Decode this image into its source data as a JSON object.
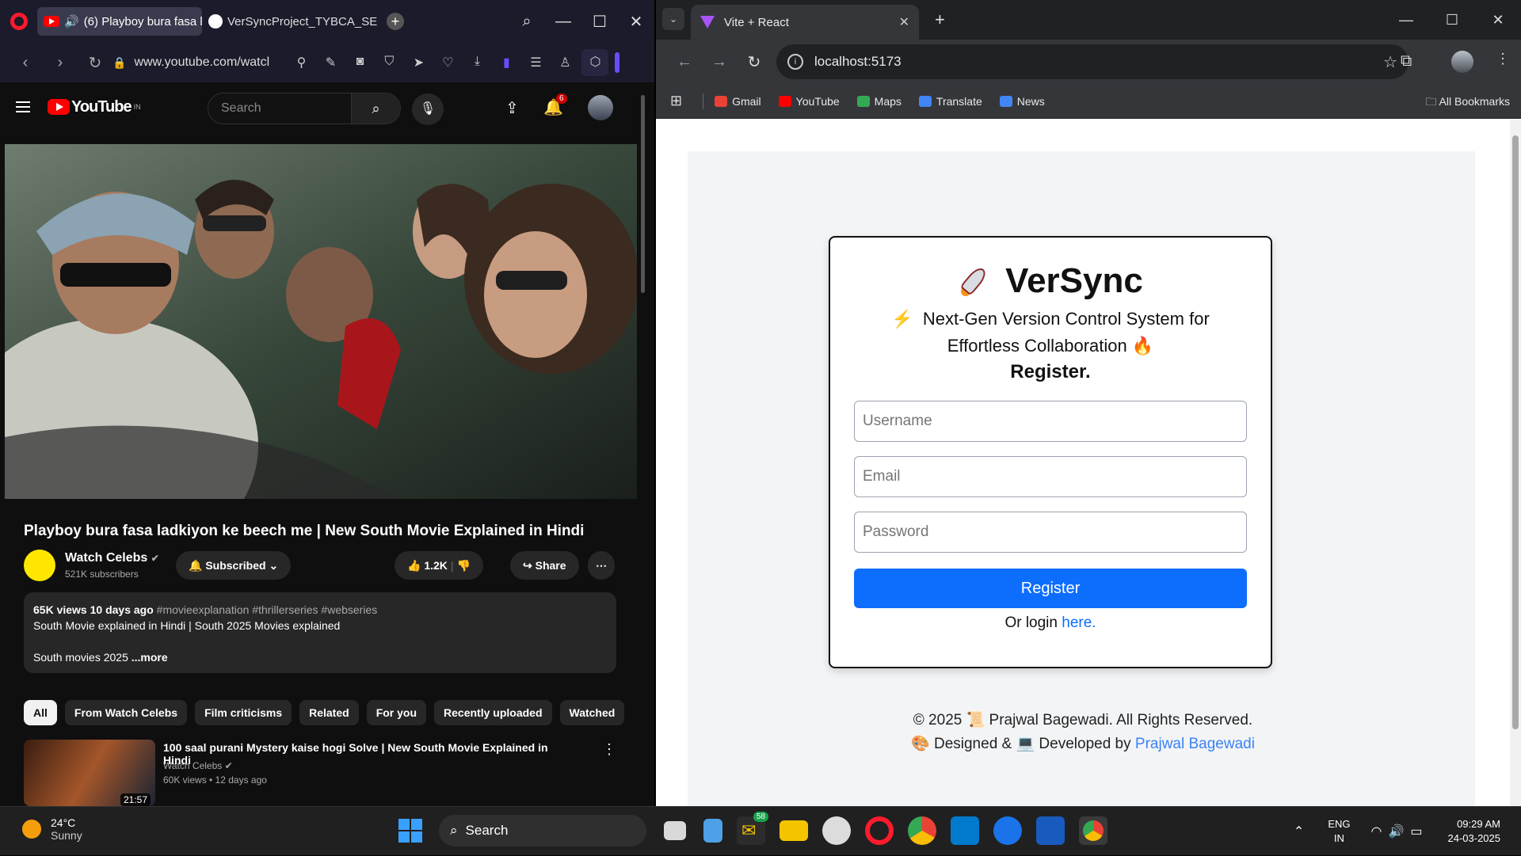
{
  "opera": {
    "tabs": [
      {
        "label": "(6) Playboy bura fasa l"
      },
      {
        "label": "VerSyncProject_TYBCA_SE"
      }
    ],
    "url": "www.youtube.com/watcl"
  },
  "youtube": {
    "logo_region": "IN",
    "search_placeholder": "Search",
    "notifications": "6",
    "video_title": "Playboy bura fasa ladkiyon ke beech me | New South Movie Explained in Hindi",
    "channel_name": "Watch Celebs",
    "subscribers": "521K subscribers",
    "subscribed_label": "Subscribed",
    "likes": "1.2K",
    "share_label": "Share",
    "views": "65K views",
    "age": "10 days ago",
    "hashtags": "#movieexplanation #thrillerseries #webseries",
    "desc_line1": "South Movie explained in Hindi | South 2025 Movies explained",
    "desc_line2": "South movies 2025",
    "more_label": "...more",
    "chips": [
      "All",
      "From Watch Celebs",
      "Film criticisms",
      "Related",
      "For you",
      "Recently uploaded",
      "Watched"
    ],
    "rec": {
      "title": "100 saal purani Mystery kaise hogi Solve | New South Movie Explained in Hindi",
      "channel": "Watch Celebs",
      "meta": "60K views • 12 days ago",
      "duration": "21:57"
    }
  },
  "chrome": {
    "tab_title": "Vite + React",
    "url": "localhost:5173",
    "bookmarks": [
      {
        "label": "Gmail",
        "color": "#ea4335"
      },
      {
        "label": "YouTube",
        "color": "#ff0000"
      },
      {
        "label": "Maps",
        "color": "#34a853"
      },
      {
        "label": "Translate",
        "color": "#4285f4"
      },
      {
        "label": "News",
        "color": "#4285f4"
      }
    ],
    "all_bookmarks": "All Bookmarks"
  },
  "versync": {
    "brand": "VerSync",
    "tagline_1": "Next-Gen Version Control System for",
    "tagline_2": "Effortless Collaboration",
    "heading": "Register.",
    "username_placeholder": "Username",
    "email_placeholder": "Email",
    "password_placeholder": "Password",
    "register_button": "Register",
    "login_prefix": "Or login",
    "login_link": "here.",
    "footer_1": "© 2025 📜 Prajwal Bagewadi. All Rights Reserved.",
    "footer_2_prefix": "🎨 Designed & 💻 Developed by",
    "footer_author": "Prajwal Bagewadi"
  },
  "taskbar": {
    "temp": "24°C",
    "weather": "Sunny",
    "search": "Search",
    "notif_badge": "58",
    "lang_1": "ENG",
    "lang_2": "IN",
    "time": "09:29 AM",
    "date": "24-03-2025"
  }
}
